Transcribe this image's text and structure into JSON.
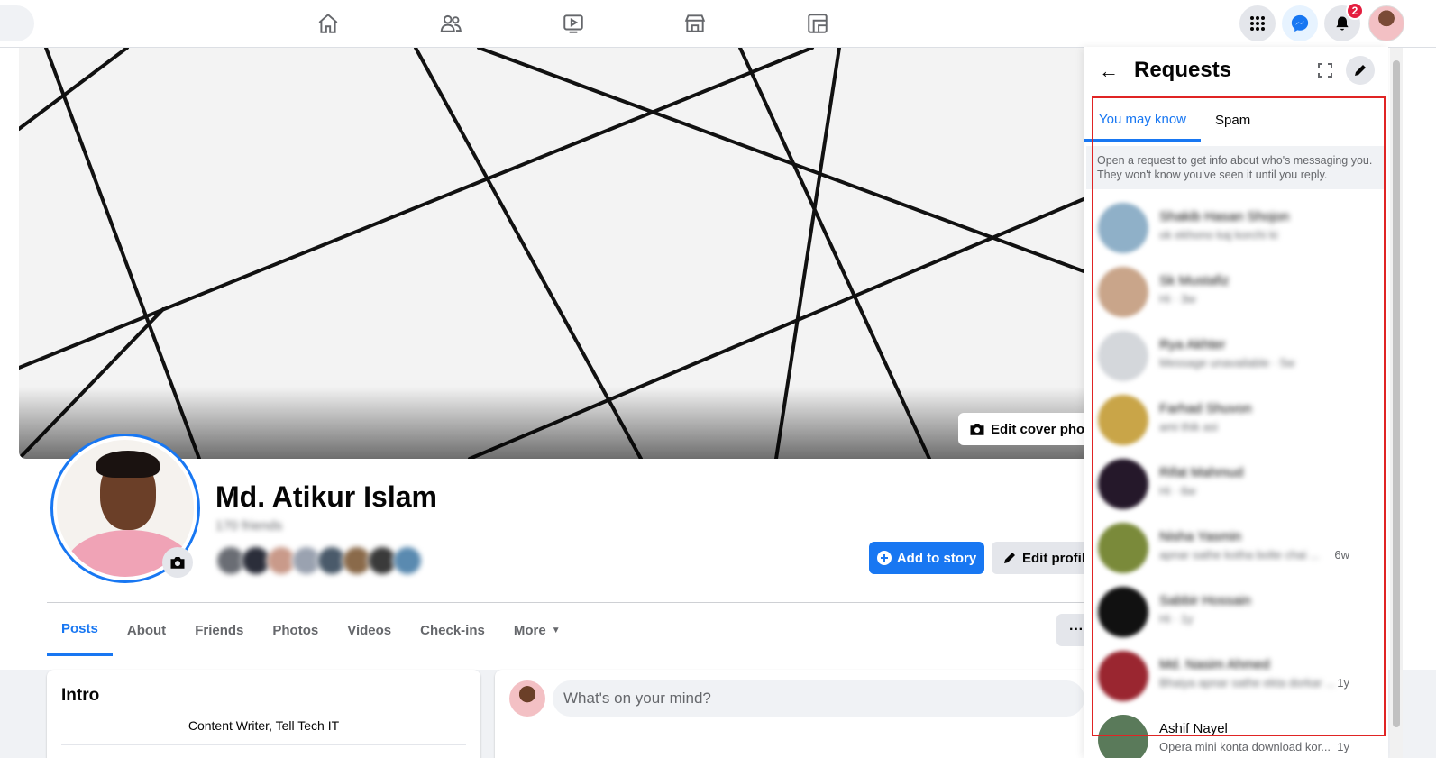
{
  "topbar": {
    "nav_icons": [
      "home-icon",
      "friends-icon",
      "watch-icon",
      "marketplace-icon",
      "gaming-icon"
    ],
    "notification_count": "2"
  },
  "profile": {
    "name": "Md. Atikur Islam",
    "friend_count": "170 friends",
    "edit_cover_label": "Edit cover photo",
    "add_story_label": "Add to story",
    "edit_profile_label": "Edit profile",
    "tabs": [
      "Posts",
      "About",
      "Friends",
      "Photos",
      "Videos",
      "Check-ins",
      "More"
    ],
    "active_tab": "Posts"
  },
  "intro": {
    "title": "Intro",
    "bio": "Content Writer, Tell Tech IT"
  },
  "composer": {
    "placeholder": "What's on your mind?"
  },
  "requests_panel": {
    "title": "Requests",
    "tabs": [
      "You may know",
      "Spam"
    ],
    "active_tab": "You may know",
    "info": "Open a request to get info about who's messaging you. They won't know you've seen it until you reply.",
    "items": [
      {
        "name": "Shakib Hasan Shojon",
        "preview": "ok ekhono kaj korchi ki",
        "time": "",
        "color": "#8fb0c8"
      },
      {
        "name": "Sk Mustafiz",
        "preview": "Hi · 3w",
        "time": "",
        "color": "#c9a58a"
      },
      {
        "name": "Rya Akhter",
        "preview": "Message unavailable · 5w",
        "time": "",
        "color": "#d4d7db"
      },
      {
        "name": "Farhad Shuvon",
        "preview": "ami thik asi",
        "time": "",
        "color": "#c9a548"
      },
      {
        "name": "Rifat Mahmud",
        "preview": "Hi · 6w",
        "time": "",
        "color": "#25182a"
      },
      {
        "name": "Nisha Yasmin",
        "preview": "apnar sathe kotha bolte chai ...",
        "time": "6w",
        "color": "#7a8a3a"
      },
      {
        "name": "Sabbir Hossain",
        "preview": "Hi · 1y",
        "time": "",
        "color": "#111111"
      },
      {
        "name": "Md. Nasim Ahmed",
        "preview": "Bhaiya apnar sathe ekta dorkar ...",
        "time": "1y",
        "color": "#9a2630"
      },
      {
        "name": "Ashif Nayel",
        "preview": "Opera mini konta download kor...",
        "time": "1y",
        "color": "#5a7a5a"
      }
    ]
  },
  "colors": {
    "accent": "#1877f2",
    "highlight_border": "#e02424",
    "badge": "#e41e3f"
  }
}
